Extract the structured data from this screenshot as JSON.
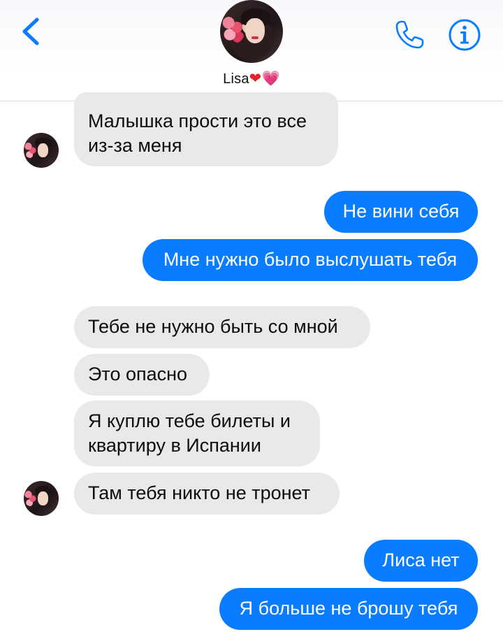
{
  "header": {
    "contact_name": "Lisa",
    "name_emoji_1": "❤",
    "name_emoji_2": "💗",
    "back_icon": "chevron-left-icon",
    "phone_icon": "phone-icon",
    "info_icon": "info-icon"
  },
  "colors": {
    "accent": "#0a7cff",
    "incoming_bubble": "#e9e9eb",
    "outgoing_text": "#ffffff",
    "incoming_text": "#0d0d0d"
  },
  "messages": [
    {
      "direction": "incoming",
      "text": "Малышка прости это все\nиз-за меня"
    },
    {
      "direction": "outgoing",
      "text": "Не вини себя"
    },
    {
      "direction": "outgoing",
      "text": "Мне нужно было выслушать тебя"
    },
    {
      "direction": "incoming",
      "text": "Тебе не нужно быть со мной"
    },
    {
      "direction": "incoming",
      "text": "Это опасно"
    },
    {
      "direction": "incoming",
      "text": "Я куплю тебе билеты и\nквартиру в Испании"
    },
    {
      "direction": "incoming",
      "text": "Там тебя никто не тронет"
    },
    {
      "direction": "outgoing",
      "text": "Лиса нет"
    },
    {
      "direction": "outgoing",
      "text": "Я больше не брошу тебя"
    }
  ]
}
